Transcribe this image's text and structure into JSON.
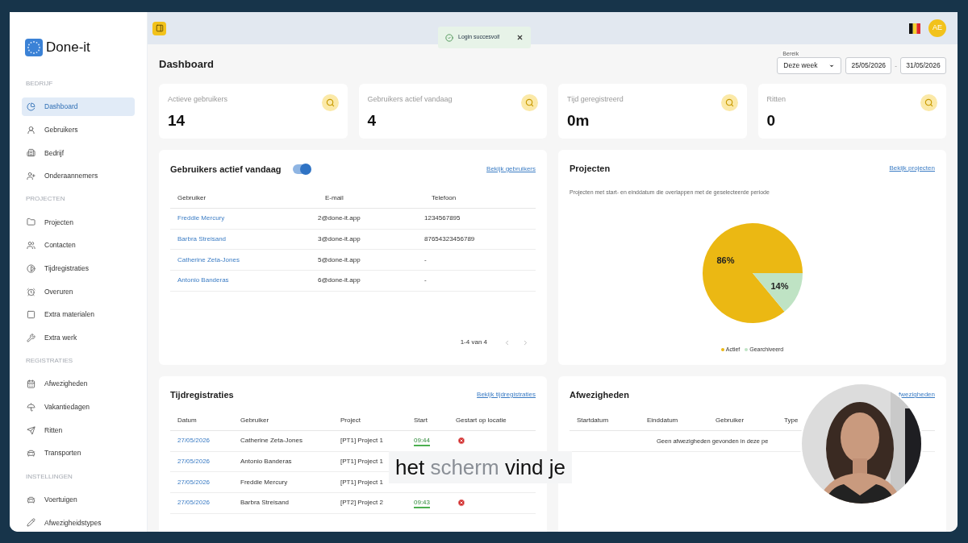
{
  "app": {
    "name": "Done-it"
  },
  "sidebar": {
    "sections": [
      {
        "title": "BEDRIJF",
        "items": [
          {
            "label": "Dashboard",
            "selected": true
          },
          {
            "label": "Gebruikers",
            "selected": false
          },
          {
            "label": "Bedrijf",
            "selected": false
          },
          {
            "label": "Onderaannemers",
            "selected": false
          }
        ]
      },
      {
        "title": "PROJECTEN",
        "items": [
          {
            "label": "Projecten",
            "selected": false
          },
          {
            "label": "Contacten",
            "selected": false
          },
          {
            "label": "Tijdregistraties",
            "selected": false
          },
          {
            "label": "Overuren",
            "selected": false
          },
          {
            "label": "Extra materialen",
            "selected": false
          },
          {
            "label": "Extra werk",
            "selected": false
          }
        ]
      },
      {
        "title": "REGISTRATIES",
        "items": [
          {
            "label": "Afwezigheden",
            "selected": false
          },
          {
            "label": "Vakantiedagen",
            "selected": false
          },
          {
            "label": "Ritten",
            "selected": false
          },
          {
            "label": "Transporten",
            "selected": false
          }
        ]
      },
      {
        "title": "INSTELLINGEN",
        "items": [
          {
            "label": "Voertuigen",
            "selected": false
          },
          {
            "label": "Afwezigheidstypes",
            "selected": false
          }
        ]
      }
    ]
  },
  "topbar": {
    "avatar": "AE"
  },
  "toast": {
    "message": "Login succesvol!"
  },
  "page": {
    "title": "Dashboard",
    "range": {
      "label": "Bereik",
      "value": "Deze week",
      "from": "25/05/2026",
      "separator": "-",
      "to": "31/05/2026"
    }
  },
  "stats": [
    {
      "label": "Actieve gebruikers",
      "value": "14"
    },
    {
      "label": "Gebruikers actief vandaag",
      "value": "4"
    },
    {
      "label": "Tijd geregistreerd",
      "value": "0m"
    },
    {
      "label": "Ritten",
      "value": "0"
    }
  ],
  "active_users": {
    "title": "Gebruikers actief vandaag",
    "toggle": {
      "on": true
    },
    "link": "Bekijk gebruikers",
    "columns": [
      "Gebruiker",
      "E-mail",
      "Telefoon"
    ],
    "rows": [
      [
        "Freddie Mercury",
        "2@done-it.app",
        "1234567895"
      ],
      [
        "Barbra Streisand",
        "3@done-it.app",
        "87654323456789"
      ],
      [
        "Catherine Zeta-Jones",
        "5@done-it.app",
        "-"
      ],
      [
        "Antonio Banderas",
        "6@done-it.app",
        "-"
      ]
    ],
    "pagination": "1-4 van 4"
  },
  "projects": {
    "title": "Projecten",
    "link": "Bekijk projecten",
    "subtitle": "Projecten met start- en einddatum die overlappen met de geselecteerde periode",
    "chart_data": {
      "type": "pie",
      "categories": [
        "Actief",
        "Gearchiveerd"
      ],
      "values": [
        86,
        14
      ],
      "value_labels": [
        "86%",
        "14%"
      ]
    },
    "legend": [
      {
        "color": "#ebb813"
      },
      {
        "color": "#bfe3c4"
      }
    ]
  },
  "time_registrations": {
    "title": "Tijdregistraties",
    "link": "Bekijk tijdregistraties",
    "columns": [
      "Datum",
      "Gebruiker",
      "Project",
      "Start",
      "Gestart op locatie"
    ],
    "rows": [
      {
        "date": "27/05/2026",
        "user": "Catherine Zeta-Jones",
        "project": "[PT1] Project 1",
        "start": "09:44",
        "on_location": false
      },
      {
        "date": "27/05/2026",
        "user": "Antonio Banderas",
        "project": "[PT1] Project 1"
      },
      {
        "date": "27/05/2026",
        "user": "Freddie Mercury",
        "project": "[PT1] Project 1"
      },
      {
        "date": "27/05/2026",
        "user": "Barbra Streisand",
        "project": "[PT2] Project 2",
        "start": "09:43",
        "on_location": false
      }
    ]
  },
  "absences": {
    "title": "Afwezigheden",
    "link": "fwezigheden",
    "columns": [
      "Startdatum",
      "Einddatum",
      "Gebruiker",
      "Type"
    ],
    "empty": "Geen afwezigheden gevonden in deze pe"
  },
  "subtitle": {
    "words": [
      {
        "text": "het",
        "highlight": false
      },
      {
        "text": "scherm",
        "highlight": true
      },
      {
        "text": "vind",
        "highlight": false
      },
      {
        "text": "je",
        "highlight": false
      }
    ]
  }
}
